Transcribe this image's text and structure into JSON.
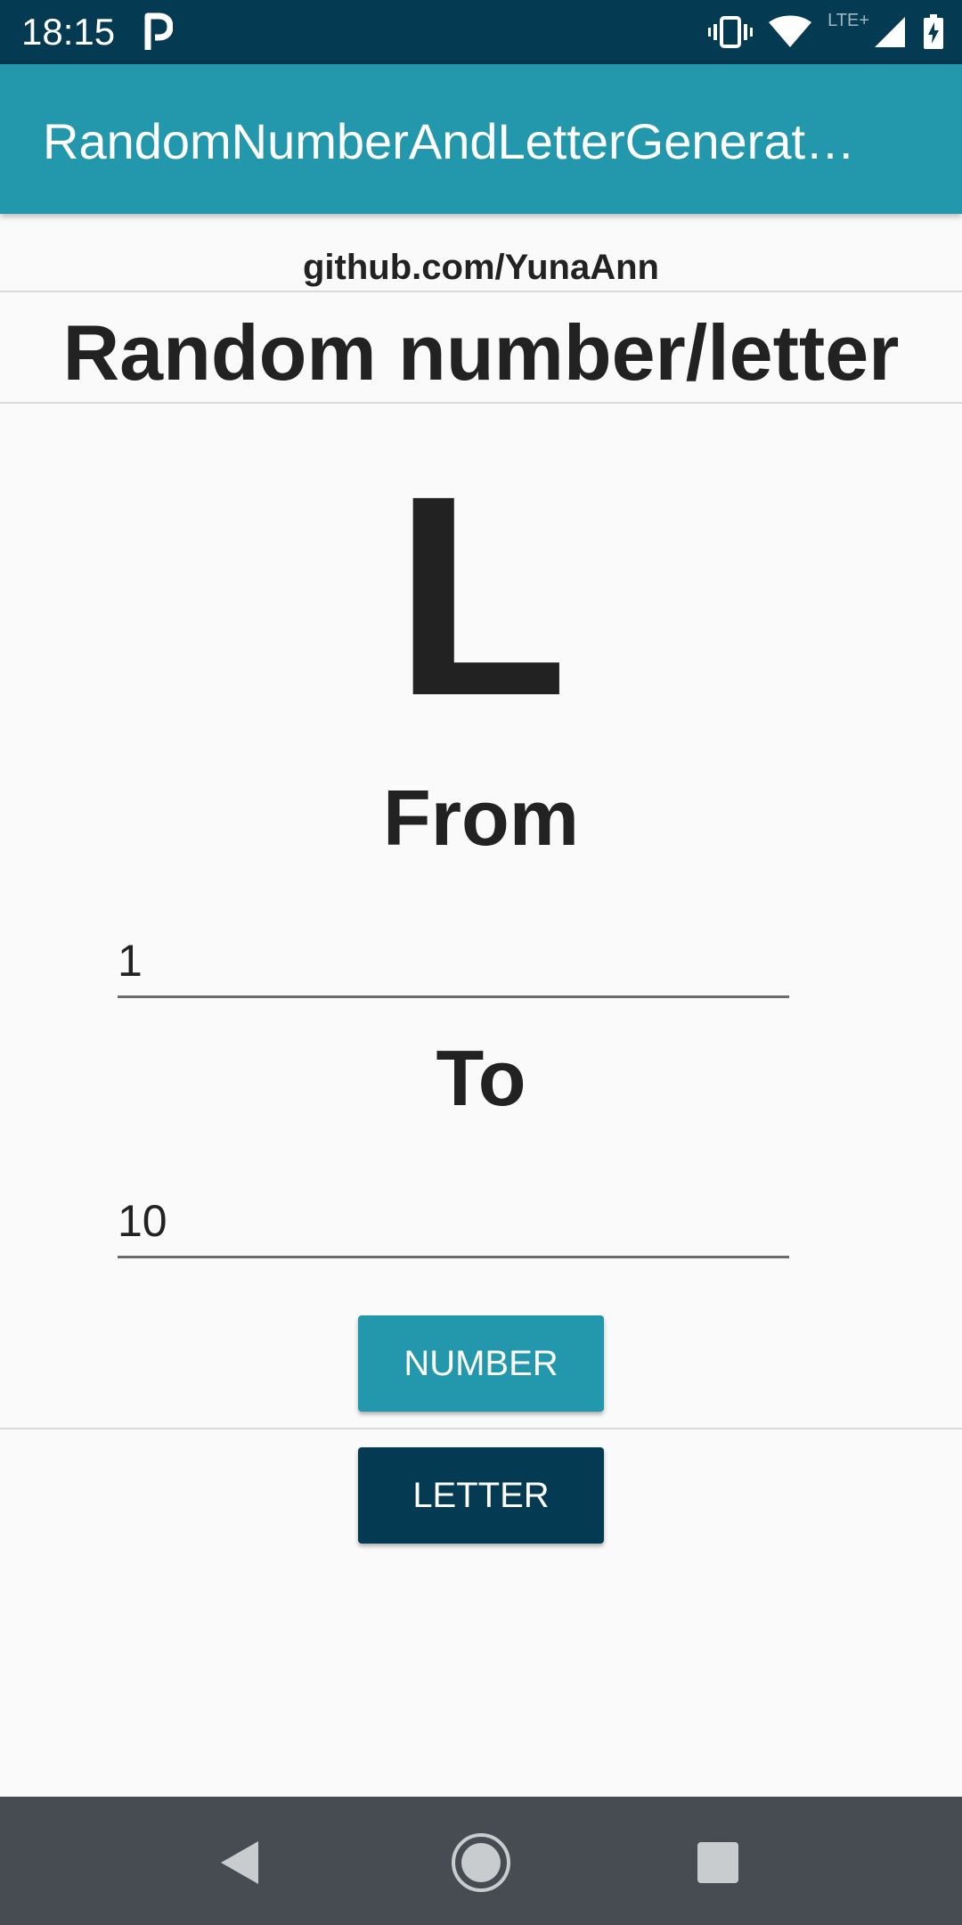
{
  "status_bar": {
    "time": "18:15",
    "network_label": "LTE+",
    "icons": [
      "parking-notification-icon",
      "vibrate-icon",
      "wifi-icon",
      "cell-signal-icon",
      "battery-charging-icon"
    ]
  },
  "app_bar": {
    "title": "RandomNumberAndLetterGenerat…"
  },
  "main": {
    "link": "github.com/YunaAnn",
    "heading": "Random number/letter",
    "result": "L",
    "from_label": "From",
    "from_value": "1",
    "to_label": "To",
    "to_value": "10",
    "number_button": "NUMBER",
    "letter_button": "LETTER"
  },
  "nav_bar": {
    "icons": [
      "back-icon",
      "home-icon",
      "recent-apps-icon"
    ]
  },
  "colors": {
    "status_bar": "#043a52",
    "app_bar": "#2398ac",
    "number_button": "#2398ac",
    "letter_button": "#043a52",
    "nav_bar": "#464c51"
  }
}
